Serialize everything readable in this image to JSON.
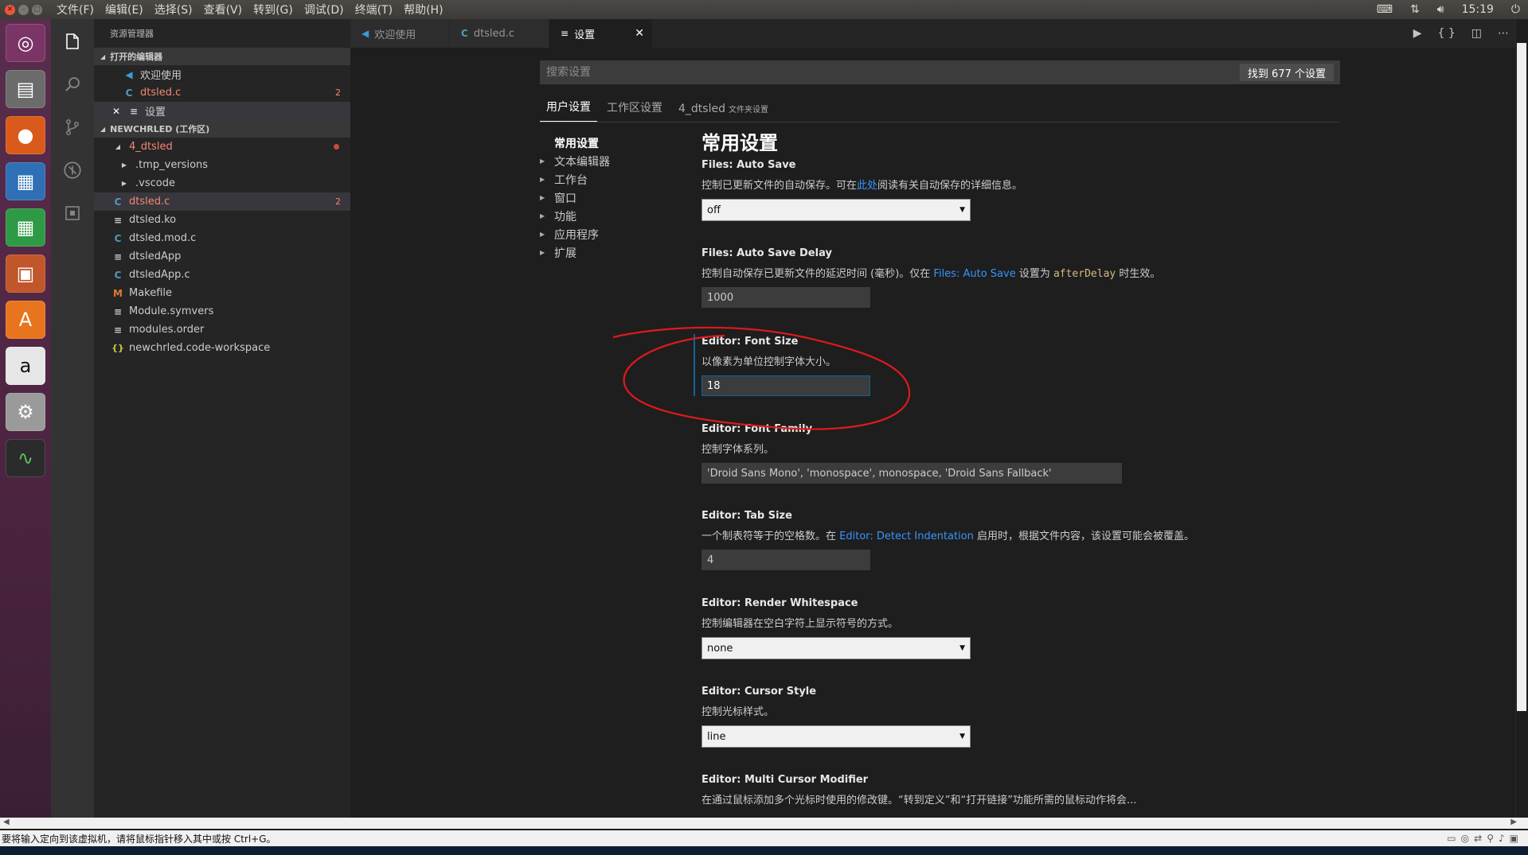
{
  "topbar": {
    "menu": [
      "文件(F)",
      "编辑(E)",
      "选择(S)",
      "查看(V)",
      "转到(G)",
      "调试(D)",
      "终端(T)",
      "帮助(H)"
    ],
    "clock": "15:19"
  },
  "sidebar": {
    "title": "资源管理器",
    "open_editors_header": "打开的编辑器",
    "open_editors": [
      {
        "icon": "vscode-icon",
        "label": "欢迎使用"
      },
      {
        "icon": "c-file-icon",
        "label": "dtsled.c",
        "badge": "2"
      },
      {
        "icon": "settings-file-icon",
        "label": "设置"
      }
    ],
    "workspace_header": "NEWCHRLED (工作区)",
    "folder": "4_dtsled",
    "files": [
      {
        "label": ".tmp_versions",
        "type": "folder"
      },
      {
        "label": ".vscode",
        "type": "folder"
      },
      {
        "label": "dtsled.c",
        "type": "c",
        "badge": "2"
      },
      {
        "label": "dtsled.ko",
        "type": "text"
      },
      {
        "label": "dtsled.mod.c",
        "type": "c"
      },
      {
        "label": "dtsledApp",
        "type": "text"
      },
      {
        "label": "dtsledApp.c",
        "type": "c"
      },
      {
        "label": "Makefile",
        "type": "makefile"
      },
      {
        "label": "Module.symvers",
        "type": "text"
      },
      {
        "label": "modules.order",
        "type": "text"
      },
      {
        "label": "newchrled.code-workspace",
        "type": "json"
      }
    ]
  },
  "tabs": [
    {
      "label": "欢迎使用",
      "icon": "vscode-icon"
    },
    {
      "label": "dtsled.c",
      "icon": "c-file-icon"
    },
    {
      "label": "设置",
      "icon": "settings-file-icon"
    }
  ],
  "settings": {
    "search_placeholder": "搜索设置",
    "result_count": "找到 677 个设置",
    "scope_tabs": {
      "user": "用户设置",
      "workspace": "工作区设置",
      "folder": "4_dtsled",
      "folder_suffix": "文件夹设置"
    },
    "toc": [
      "常用设置",
      "文本编辑器",
      "工作台",
      "窗口",
      "功能",
      "应用程序",
      "扩展"
    ],
    "section_title": "常用设置",
    "items": {
      "auto_save": {
        "prefix": "Files: ",
        "name": "Auto Save",
        "desc_a": "控制已更新文件的自动保存。可在",
        "desc_link": "此处",
        "desc_b": "阅读有关自动保存的详细信息。",
        "value": "off"
      },
      "auto_save_delay": {
        "prefix": "Files: ",
        "name": "Auto Save Delay",
        "desc_a": "控制自动保存已更新文件的延迟时间 (毫秒)。仅在 ",
        "desc_link": "Files: Auto Save",
        "desc_b": " 设置为 ",
        "desc_code": "afterDelay",
        "desc_c": " 时生效。",
        "value": "1000"
      },
      "font_size": {
        "prefix": "Editor: ",
        "name": "Font Size",
        "desc": "以像素为单位控制字体大小。",
        "value": "18"
      },
      "font_family": {
        "prefix": "Editor: ",
        "name": "Font Family",
        "desc": "控制字体系列。",
        "value": "'Droid Sans Mono', 'monospace', monospace, 'Droid Sans Fallback'"
      },
      "tab_size": {
        "prefix": "Editor: ",
        "name": "Tab Size",
        "desc_a": "一个制表符等于的空格数。在 ",
        "desc_link": "Editor: Detect Indentation",
        "desc_b": " 启用时，根据文件内容，该设置可能会被覆盖。",
        "value": "4"
      },
      "render_whitespace": {
        "prefix": "Editor: ",
        "name": "Render Whitespace",
        "desc": "控制编辑器在空白字符上显示符号的方式。",
        "value": "none"
      },
      "cursor_style": {
        "prefix": "Editor: ",
        "name": "Cursor Style",
        "desc": "控制光标样式。",
        "value": "line"
      },
      "multi_cursor": {
        "prefix": "Editor: ",
        "name": "Multi Cursor Modifier",
        "desc": "在通过鼠标添加多个光标时使用的修改键。“转到定义”和“打开链接”功能所需的鼠标动作将会..."
      }
    }
  },
  "vm_status": "要将输入定向到该虚拟机，请将鼠标指针移入其中或按 Ctrl+G。",
  "colors": {
    "accent": "#0e639c",
    "link": "#3794ff",
    "error": "#f48771",
    "annotation": "#e0191d"
  }
}
